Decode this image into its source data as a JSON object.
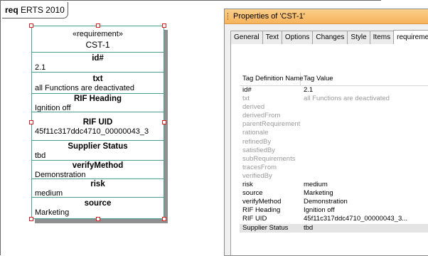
{
  "diagram": {
    "frame_keyword": "req",
    "frame_name": "ERTS 2010",
    "requirement": {
      "stereotype": "«requirement»",
      "name": "CST-1",
      "sections": [
        {
          "header": "id#",
          "value": "2.1"
        },
        {
          "header": "txt",
          "value": "all Functions are deactivated"
        },
        {
          "header": "RIF Heading",
          "value": "Ignition off"
        },
        {
          "header": "RIF UID",
          "value": "45f11c317ddc4710_00000043_3"
        },
        {
          "header": "Supplier Status",
          "value": "tbd"
        },
        {
          "header": "verifyMethod",
          "value": "Demonstration"
        },
        {
          "header": "risk",
          "value": "medium"
        },
        {
          "header": "source",
          "value": "Marketing"
        }
      ]
    }
  },
  "properties": {
    "title": "Properties of 'CST-1'",
    "tabs": [
      {
        "label": "General",
        "active": false
      },
      {
        "label": "Text",
        "active": false
      },
      {
        "label": "Options",
        "active": false
      },
      {
        "label": "Changes",
        "active": false
      },
      {
        "label": "Style",
        "active": false
      },
      {
        "label": "Items",
        "active": false
      },
      {
        "label": "requirement",
        "active": true
      }
    ],
    "grid": {
      "col_name": "Tag Definition Name",
      "col_value": "Tag Value",
      "rows": [
        {
          "name": "id#",
          "value": "2.1",
          "filled": true
        },
        {
          "name": "txt",
          "value": "all Functions are deactivated",
          "filled": false
        },
        {
          "name": "derived",
          "value": "",
          "filled": false
        },
        {
          "name": "derivedFrom",
          "value": "",
          "filled": false
        },
        {
          "name": "parentRequirement",
          "value": "",
          "filled": false
        },
        {
          "name": "rationale",
          "value": "",
          "filled": false
        },
        {
          "name": "refinedBy",
          "value": "",
          "filled": false
        },
        {
          "name": "satisfiedBy",
          "value": "",
          "filled": false
        },
        {
          "name": "subRequirements",
          "value": "",
          "filled": false
        },
        {
          "name": "tracesFrom",
          "value": "",
          "filled": false
        },
        {
          "name": "verifiedBy",
          "value": "",
          "filled": false
        },
        {
          "name": "risk",
          "value": "medium",
          "filled": true
        },
        {
          "name": "source",
          "value": "Marketing",
          "filled": true
        },
        {
          "name": "verifyMethod",
          "value": "Demonstration",
          "filled": true
        },
        {
          "name": "RIF Heading",
          "value": "Ignition off",
          "filled": true
        },
        {
          "name": "RIF UID",
          "value": "45f11c317ddc4710_00000043_3...",
          "filled": true
        },
        {
          "name": "Supplier Status",
          "value": "tbd",
          "filled": true,
          "selected": true
        }
      ]
    }
  },
  "colors": {
    "element_border": "#4a9d93",
    "selection_handle": "#d62020",
    "titlebar": "#f6b35c",
    "muted_text": "#9a9a9a"
  }
}
